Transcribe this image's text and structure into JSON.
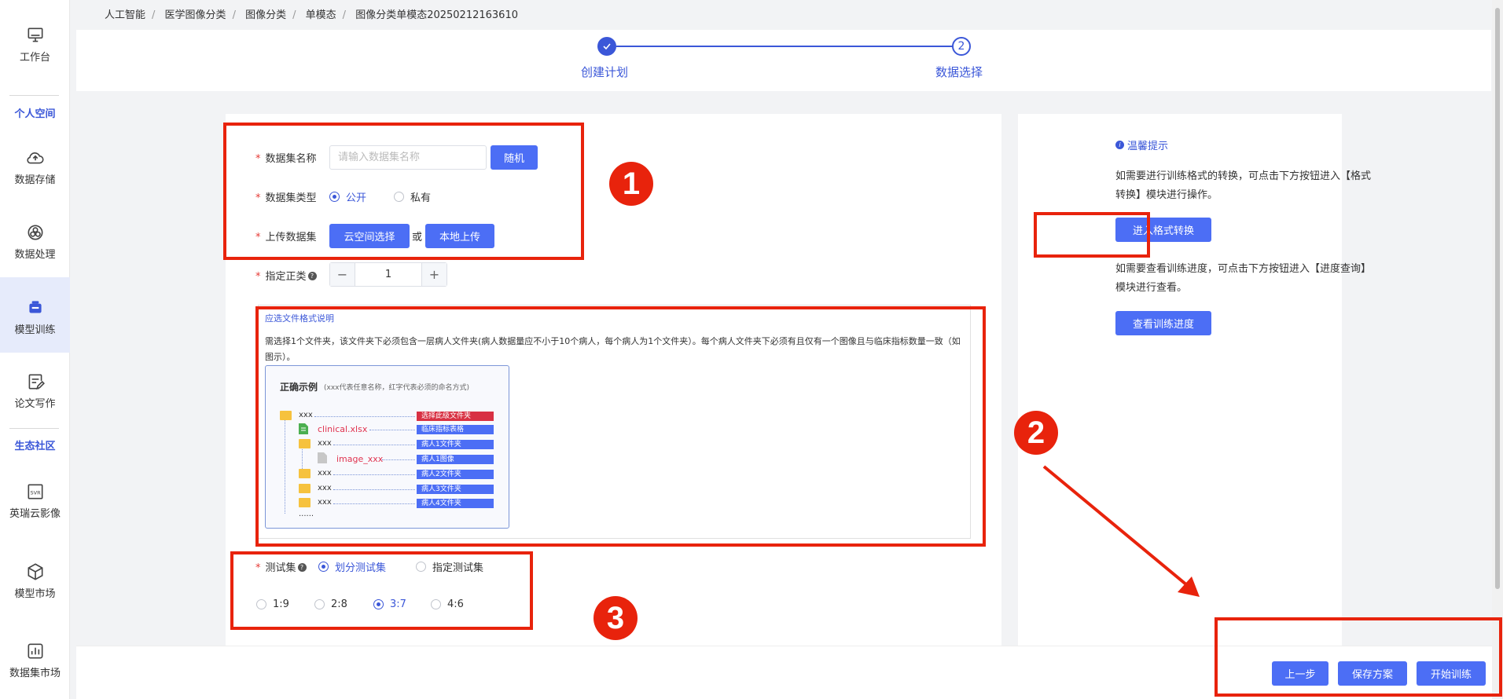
{
  "sidebar": {
    "items": [
      {
        "label": "工作台",
        "icon": "monitor-icon"
      },
      {
        "label": "数据存储",
        "icon": "cloud-upload-icon"
      },
      {
        "label": "数据处理",
        "icon": "data-process-icon"
      },
      {
        "label": "模型训练",
        "icon": "model-train-icon"
      },
      {
        "label": "论文写作",
        "icon": "paper-edit-icon"
      },
      {
        "label": "英瑞云影像",
        "icon": "cloud-image-icon"
      },
      {
        "label": "模型市场",
        "icon": "cube-icon"
      },
      {
        "label": "数据集市场",
        "icon": "bar-chart-icon"
      }
    ],
    "sections": [
      "个人空间",
      "生态社区"
    ],
    "active": "模型训练"
  },
  "breadcrumb": [
    "人工智能",
    "医学图像分类",
    "图像分类",
    "单模态",
    "图像分类单模态20250212163610"
  ],
  "steps": [
    {
      "index": "1",
      "label": "创建计划",
      "state": "done",
      "icon": "check-icon"
    },
    {
      "index": "2",
      "label": "数据选择",
      "state": "current"
    }
  ],
  "form": {
    "dataset_name": {
      "label": "数据集名称",
      "placeholder": "请输入数据集名称",
      "value": "",
      "random_btn": "随机"
    },
    "dataset_type": {
      "label": "数据集类型",
      "options": [
        "公开",
        "私有"
      ],
      "selected": "公开"
    },
    "upload": {
      "label": "上传数据集",
      "cloud_btn": "云空间选择",
      "or": "或",
      "local_btn": "本地上传"
    },
    "positive_class": {
      "label": "指定正类",
      "value": "1",
      "minus": "−",
      "plus": "+"
    },
    "format": {
      "title": "应选文件格式说明",
      "desc": "需选择1个文件夹，该文件夹下必须包含一层病人文件夹(病人数据量应不小于10个病人，每个病人为1个文件夹）。每个病人文件夹下必须有且仅有一个图像且与临床指标数量一致（如图示）。",
      "example_title": "正确示例",
      "example_note": "(xxx代表任意名称，红字代表必须的命名方式)",
      "tree": [
        {
          "text": "xxx",
          "red": false,
          "tag": "选择此级文件夹",
          "tag_red": true
        },
        {
          "text": "clinical.xlsx",
          "red": true,
          "tag": "临床指标表格",
          "tag_red": false
        },
        {
          "text": "xxx",
          "red": false,
          "tag": "病人1文件夹",
          "tag_red": false
        },
        {
          "text": "image_xxx",
          "red": true,
          "tag": "病人1图像",
          "tag_red": false
        },
        {
          "text": "xxx",
          "red": false,
          "tag": "病人2文件夹",
          "tag_red": false
        },
        {
          "text": "xxx",
          "red": false,
          "tag": "病人3文件夹",
          "tag_red": false
        },
        {
          "text": "xxx",
          "red": false,
          "tag": "病人4文件夹",
          "tag_red": false
        }
      ],
      "ellipsis": "......"
    },
    "test_set": {
      "label": "测试集",
      "modes": [
        "划分测试集",
        "指定测试集"
      ],
      "mode_selected": "划分测试集",
      "ratios": [
        "1:9",
        "2:8",
        "3:7",
        "4:6"
      ],
      "ratio_selected": "3:7"
    }
  },
  "tips": {
    "title": "温馨提示",
    "text1": "如需要进行训练格式的转换，可点击下方按钮进入【格式转换】模块进行操作。",
    "btn1": "进入格式转换",
    "text2": "如需要查看训练进度，可点击下方按钮进入【进度查询】模块进行查看。",
    "btn2": "查看训练进度"
  },
  "footer": {
    "prev": "上一步",
    "save": "保存方案",
    "start": "开始训练"
  },
  "annotations": {
    "badge1": "1",
    "badge2": "2",
    "badge3": "3"
  },
  "colors": {
    "primary": "#4c6ef5",
    "accent": "#3b57d8",
    "annotation": "#e8230c"
  }
}
